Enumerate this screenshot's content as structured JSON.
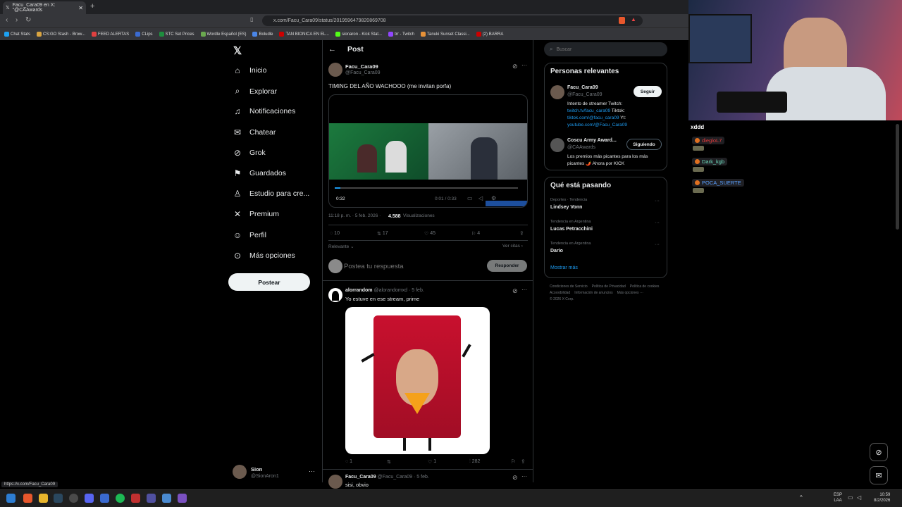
{
  "browser": {
    "tab_title": "Facu_Cara09 en X: \"@CAAwards",
    "url": "x.com/Facu_Cara09/status/2019596479820869708",
    "status_url": "https://x.com/Facu_Cara09",
    "bookmarks": [
      "Chat Stats",
      "CS:GO Stash - Brow...",
      "FEED ALERTAS",
      "CLips",
      "STC Set Prices",
      "Wordle Español (ES)",
      "Boludle",
      "TAN BIONICA EN EL...",
      "sionaron - Kick Stat...",
      "trr - Twitch",
      "Tanuki Sunset Classi...",
      "(2) BARRA"
    ]
  },
  "sidebar": {
    "items": [
      {
        "label": "Inicio",
        "icon": "home-icon",
        "glyph": "⌂"
      },
      {
        "label": "Explorar",
        "icon": "search-icon",
        "glyph": "⌕"
      },
      {
        "label": "Notificaciones",
        "icon": "bell-icon",
        "glyph": "♫"
      },
      {
        "label": "Chatear",
        "icon": "mail-icon",
        "glyph": "✉"
      },
      {
        "label": "Grok",
        "icon": "grok-icon",
        "glyph": "⊘"
      },
      {
        "label": "Guardados",
        "icon": "bookmark-icon",
        "glyph": "⚑"
      },
      {
        "label": "Estudio para cre...",
        "icon": "studio-icon",
        "glyph": "♙"
      },
      {
        "label": "Premium",
        "icon": "x-premium-icon",
        "glyph": "✕"
      },
      {
        "label": "Perfil",
        "icon": "profile-icon",
        "glyph": "☺"
      },
      {
        "label": "Más opciones",
        "icon": "more-circle-icon",
        "glyph": "⊙"
      }
    ],
    "post_button": "Postear",
    "account": {
      "name": "Sion",
      "handle": "@SionAron1"
    }
  },
  "header": {
    "title": "Post"
  },
  "post": {
    "name": "Facu_Cara09",
    "handle": "@Facu_Cara09",
    "text": "TIMING DEL AÑO WACHOOO (me invitan porfa)",
    "video_elapsed": "0:32",
    "video_time": "0:01 / 0:33",
    "timestamp": "11:18 p. m. · 5 feb. 2026 ·",
    "views": "4.588",
    "views_label": "Visualizaciones",
    "replies": "10",
    "reposts": "17",
    "likes": "45",
    "bookmarks": "4",
    "sort": "Relevante",
    "quotes_link": "Ver citas"
  },
  "reply_box": {
    "placeholder": "Postea tu respuesta",
    "button": "Responder"
  },
  "replies": [
    {
      "name": "alorrandom",
      "handle": "@alorandomxd · 5 feb.",
      "text": "Yo estuve en ese stream, prime",
      "replies": "1",
      "likes": "1",
      "views": "282"
    },
    {
      "name": "Facu_Cara09",
      "handle": "@Facu_Cara09 · 5 feb.",
      "text": "sisi, obvio"
    }
  ],
  "right": {
    "search_placeholder": "Buscar",
    "relevant_title": "Personas relevantes",
    "people": [
      {
        "name": "Facu_Cara09",
        "handle": "@Facu_Cara09",
        "button": "Seguir",
        "bio_prefix": "Intento de streamer Twitch:",
        "bio_link1": "twitch.tv/facu_cara09",
        "bio_mid": "Tiktok:",
        "bio_link2": "tiktok.com/@facu_cara09",
        "bio_mid2": "Yt:",
        "bio_link3": "youtube.com/@Facu_Cara09"
      },
      {
        "name": "Coscu Army Award...",
        "handle": "@CAAwards",
        "button": "Siguiendo",
        "bio": "Los premios más picantes para los más picantes 🌶️ Ahora por KICK"
      }
    ],
    "trending_title": "Qué está pasando",
    "trends": [
      {
        "context": "Deportes · Tendencia",
        "name": "Lindsey Vonn"
      },
      {
        "context": "Tendencia en Argentina",
        "name": "Lucas Petracchini"
      },
      {
        "context": "Tendencia en Argentina",
        "name": "Dario"
      }
    ],
    "show_more": "Mostrar más",
    "footer": [
      "Condiciones de Servicio",
      "Política de Privacidad",
      "Política de cookies",
      "Accesibilidad",
      "Información de anuncios",
      "Más opciones ···",
      "© 2026 X Corp."
    ]
  },
  "chat": {
    "first_message": "xddd",
    "users": [
      {
        "name": "diegloL7",
        "color": "#e03a3a"
      },
      {
        "name": "Dark_kgb",
        "color": "#6fe0c0"
      },
      {
        "name": "POCA_SUERTE",
        "color": "#5aa0ff"
      }
    ]
  },
  "taskbar": {
    "lang": "ESP",
    "layout": "LAA",
    "time": "10:59",
    "date": "8/2/2026"
  }
}
